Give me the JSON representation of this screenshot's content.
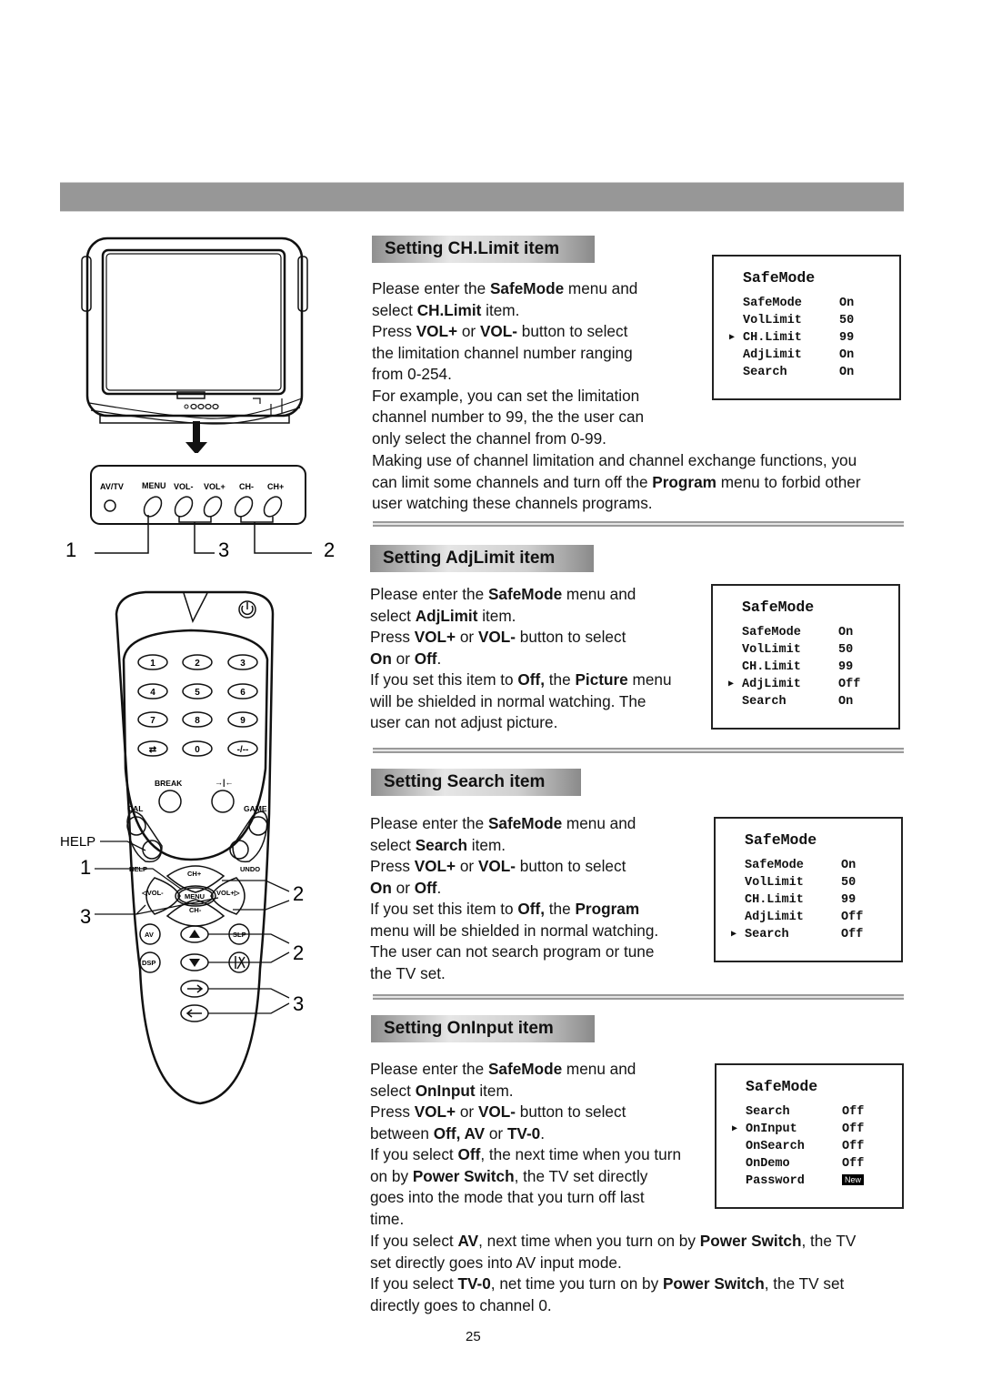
{
  "page": {
    "number": "25"
  },
  "diagrams": {
    "tv_panel_labels": [
      "AV/TV",
      "MENU",
      "VOL-",
      "VOL+",
      "CH-",
      "CH+"
    ],
    "tv_callouts": [
      "1",
      "3",
      "2"
    ],
    "remote": {
      "number_keys": [
        "1",
        "2",
        "3",
        "4",
        "5",
        "6",
        "7",
        "8",
        "9",
        "⇄",
        "0",
        "-/--"
      ],
      "labels": {
        "break": "BREAK",
        "hold": "→|←",
        "cal": "CAL",
        "game": "GAME",
        "help_outside": "HELP",
        "help_inside": "HELP",
        "undo": "UNDO",
        "ch_plus": "CH+",
        "ch_minus": "CH-",
        "vol_minus": "◁VOL-",
        "vol_plus": "VOL+▷",
        "menu": "MENU",
        "av": "AV",
        "dsp": "DSP",
        "slp": "SLP"
      },
      "callouts_left": [
        "1",
        "3"
      ],
      "callouts_right": [
        "2",
        "2",
        "3"
      ]
    }
  },
  "sections": [
    {
      "title": "Setting CH.Limit item",
      "paragraphs": [
        [
          {
            "t": "Please enter the "
          },
          {
            "t": "SafeMode",
            "b": true
          },
          {
            "t": " menu and"
          }
        ],
        [
          {
            "t": "select "
          },
          {
            "t": "CH.Limit",
            "b": true
          },
          {
            "t": " item."
          }
        ],
        [
          {
            "t": "Press "
          },
          {
            "t": "VOL+",
            "b": true
          },
          {
            "t": " or "
          },
          {
            "t": "VOL-",
            "b": true
          },
          {
            "t": " button to select"
          }
        ],
        [
          {
            "t": "the limitation channel number ranging"
          }
        ],
        [
          {
            "t": "from 0-254."
          }
        ],
        [
          {
            "t": "For example, you can set the limitation"
          }
        ],
        [
          {
            "t": "channel number to 99, the the user can"
          }
        ],
        [
          {
            "t": "only select the channel from 0-99."
          }
        ]
      ],
      "extra_paragraphs": [
        [
          {
            "t": "Making use of channel limitation and channel exchange functions, you"
          }
        ],
        [
          {
            "t": "can limit some channels and turn off the "
          },
          {
            "t": "Program",
            "b": true
          },
          {
            "t": " menu to forbid other"
          }
        ],
        [
          {
            "t": "user watching these channels programs."
          }
        ]
      ],
      "osd": {
        "title": "SafeMode",
        "rows": [
          {
            "label": "SafeMode",
            "value": "On"
          },
          {
            "label": "VolLimit",
            "value": "50"
          },
          {
            "label": "CH.Limit",
            "value": "99",
            "selected": true
          },
          {
            "label": "AdjLimit",
            "value": "On"
          },
          {
            "label": "Search",
            "value": "On"
          }
        ]
      }
    },
    {
      "title": "Setting AdjLimit item",
      "paragraphs": [
        [
          {
            "t": "Please enter the "
          },
          {
            "t": "SafeMode",
            "b": true
          },
          {
            "t": " menu and"
          }
        ],
        [
          {
            "t": "select "
          },
          {
            "t": "AdjLimit",
            "b": true
          },
          {
            "t": " item."
          }
        ],
        [
          {
            "t": "Press "
          },
          {
            "t": "VOL+",
            "b": true
          },
          {
            "t": " or "
          },
          {
            "t": "VOL-",
            "b": true
          },
          {
            "t": " button to select"
          }
        ],
        [
          {
            "t": "On",
            "b": true
          },
          {
            "t": " or "
          },
          {
            "t": "Off",
            "b": true
          },
          {
            "t": "."
          }
        ],
        [
          {
            "t": "If you set this item to "
          },
          {
            "t": "Off,",
            "b": true
          },
          {
            "t": " the "
          },
          {
            "t": "Picture",
            "b": true
          },
          {
            "t": " menu"
          }
        ],
        [
          {
            "t": "will be shielded in normal watching. The"
          }
        ],
        [
          {
            "t": "user can not adjust picture."
          }
        ]
      ],
      "osd": {
        "title": "SafeMode",
        "rows": [
          {
            "label": "SafeMode",
            "value": "On"
          },
          {
            "label": "VolLimit",
            "value": "50"
          },
          {
            "label": "CH.Limit",
            "value": "99"
          },
          {
            "label": "AdjLimit",
            "value": "Off",
            "selected": true
          },
          {
            "label": "Search",
            "value": "On"
          }
        ]
      }
    },
    {
      "title": "Setting Search item",
      "paragraphs": [
        [
          {
            "t": "Please enter the "
          },
          {
            "t": "SafeMode",
            "b": true
          },
          {
            "t": " menu and"
          }
        ],
        [
          {
            "t": "select "
          },
          {
            "t": "Search",
            "b": true
          },
          {
            "t": " item."
          }
        ],
        [
          {
            "t": "Press "
          },
          {
            "t": "VOL+",
            "b": true
          },
          {
            "t": " or "
          },
          {
            "t": "VOL-",
            "b": true
          },
          {
            "t": " button to select"
          }
        ],
        [
          {
            "t": "On",
            "b": true
          },
          {
            "t": " or "
          },
          {
            "t": "Off",
            "b": true
          },
          {
            "t": "."
          }
        ],
        [
          {
            "t": "If you set this item to "
          },
          {
            "t": "Off,",
            "b": true
          },
          {
            "t": " the "
          },
          {
            "t": "Program",
            "b": true
          }
        ],
        [
          {
            "t": "menu will be shielded in normal watching."
          }
        ],
        [
          {
            "t": "The user can not search program or tune"
          }
        ],
        [
          {
            "t": "the TV set."
          }
        ]
      ],
      "osd": {
        "title": "SafeMode",
        "rows": [
          {
            "label": "SafeMode",
            "value": "On"
          },
          {
            "label": "VolLimit",
            "value": "50"
          },
          {
            "label": "CH.Limit",
            "value": "99"
          },
          {
            "label": "AdjLimit",
            "value": "Off"
          },
          {
            "label": "Search",
            "value": "Off",
            "selected": true
          }
        ]
      }
    },
    {
      "title": "Setting OnInput item",
      "paragraphs": [
        [
          {
            "t": "Please enter the "
          },
          {
            "t": "SafeMode",
            "b": true
          },
          {
            "t": " menu and"
          }
        ],
        [
          {
            "t": "select "
          },
          {
            "t": "OnInput",
            "b": true
          },
          {
            "t": " item."
          }
        ],
        [
          {
            "t": "Press "
          },
          {
            "t": "VOL+",
            "b": true
          },
          {
            "t": " or "
          },
          {
            "t": "VOL-",
            "b": true
          },
          {
            "t": " button to select"
          }
        ],
        [
          {
            "t": "between "
          },
          {
            "t": "Off, AV",
            "b": true
          },
          {
            "t": " or "
          },
          {
            "t": "TV-0",
            "b": true
          },
          {
            "t": "."
          }
        ],
        [
          {
            "t": "If you select "
          },
          {
            "t": "Off",
            "b": true
          },
          {
            "t": ", the next time when you turn"
          }
        ],
        [
          {
            "t": "on by "
          },
          {
            "t": "Power Switch",
            "b": true
          },
          {
            "t": ", the TV set directly"
          }
        ],
        [
          {
            "t": "goes into the mode that you turn off last"
          }
        ],
        [
          {
            "t": "time."
          }
        ]
      ],
      "extra_paragraphs": [
        [
          {
            "t": "If you select "
          },
          {
            "t": "AV",
            "b": true
          },
          {
            "t": ", next time when you turn on by "
          },
          {
            "t": "Power Switch",
            "b": true
          },
          {
            "t": ", the TV"
          }
        ],
        [
          {
            "t": "set directly goes into AV input mode."
          }
        ],
        [
          {
            "t": "If you select "
          },
          {
            "t": "TV-0",
            "b": true
          },
          {
            "t": ", net time you turn on by "
          },
          {
            "t": "Power Switch",
            "b": true
          },
          {
            "t": ", the TV set"
          }
        ],
        [
          {
            "t": "directly goes to channel 0."
          }
        ]
      ],
      "osd": {
        "title": "SafeMode",
        "rows": [
          {
            "label": "Search",
            "value": "Off"
          },
          {
            "label": "OnInput",
            "value": "Off",
            "selected": true
          },
          {
            "label": "OnSearch",
            "value": "Off"
          },
          {
            "label": "OnDemo",
            "value": "Off"
          },
          {
            "label": "Password",
            "value": "New",
            "badge": true
          }
        ]
      }
    }
  ]
}
